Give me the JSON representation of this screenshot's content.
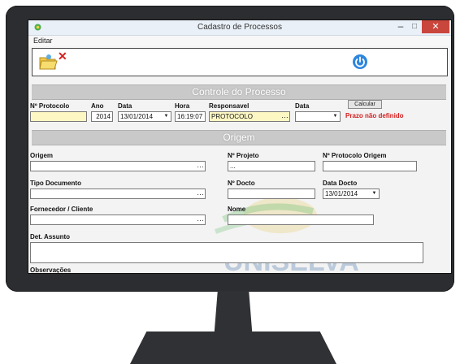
{
  "window": {
    "title": "Cadastro de Processos",
    "minimize": "–",
    "maximize": "□",
    "close": "✕"
  },
  "menu": {
    "edit": "Editar"
  },
  "toolbar": {
    "icons": [
      "folder-open-icon",
      "delete-x-icon",
      "power-icon"
    ]
  },
  "controle": {
    "heading": "Controle do Processo",
    "protocolo_label": "Nº Protocolo",
    "protocolo_value": "",
    "ano_label": "Ano",
    "ano_value": "2014",
    "data_label": "Data",
    "data_value": "13/01/2014",
    "hora_label": "Hora",
    "hora_value": "16:19:07",
    "responsavel_label": "Responsavel",
    "responsavel_value": "PROTOCOLO",
    "data2_label": "Data",
    "data2_value": "",
    "button_label": "Calcular",
    "prazo_warning": "Prazo não definido"
  },
  "origem": {
    "heading": "Origem",
    "origem_label": "Origem",
    "projeto_label": "Nº Projeto",
    "projeto_value": "...",
    "protocolo_origem_label": "Nº Protocolo Origem",
    "tipo_documento_label": "Tipo Documento",
    "docto_label": "Nº Docto",
    "data_docto_label": "Data Docto",
    "data_docto_value": "13/01/2014",
    "fornecedor_label": "Fornecedor / Cliente",
    "nome_label": "Nome",
    "assunto_label": "Det. Assunto",
    "observacoes_label": "Observações",
    "watermark_text": "UNISELVA"
  },
  "colors": {
    "yellow_field": "#fdf7c4",
    "warning": "#d42020",
    "section_bar": "#c9c9c9",
    "close": "#c9463d"
  }
}
